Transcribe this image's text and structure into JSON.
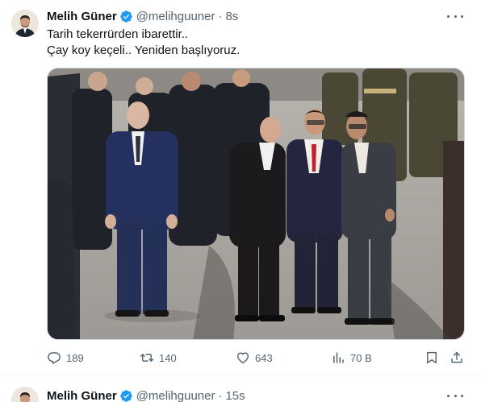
{
  "tweets": [
    {
      "author": {
        "name": "Melih Güner",
        "handle": "@melihguuner",
        "verified": true
      },
      "separator": "·",
      "time": "8s",
      "text_lines": [
        "Tarih tekerrürden ibarettir..",
        "Çay koy keçeli.. Yeniden başlıyoruz."
      ],
      "metrics": {
        "replies": "189",
        "retweets": "140",
        "likes": "643",
        "views": "70 B"
      }
    },
    {
      "author": {
        "name": "Melih Güner",
        "handle": "@melihguuner",
        "verified": true
      },
      "separator": "·",
      "time": "15s"
    }
  ],
  "icons": {
    "verified": "verified-badge-icon",
    "more": "more-dots-icon",
    "reply": "reply-icon",
    "retweet": "retweet-icon",
    "like": "heart-icon",
    "views": "views-bar-chart-icon",
    "bookmark": "bookmark-icon",
    "share": "share-icon"
  },
  "colors": {
    "text": "#0f1419",
    "secondary": "#536471",
    "verified": "#1d9bf0",
    "border": "#eff3f4"
  }
}
